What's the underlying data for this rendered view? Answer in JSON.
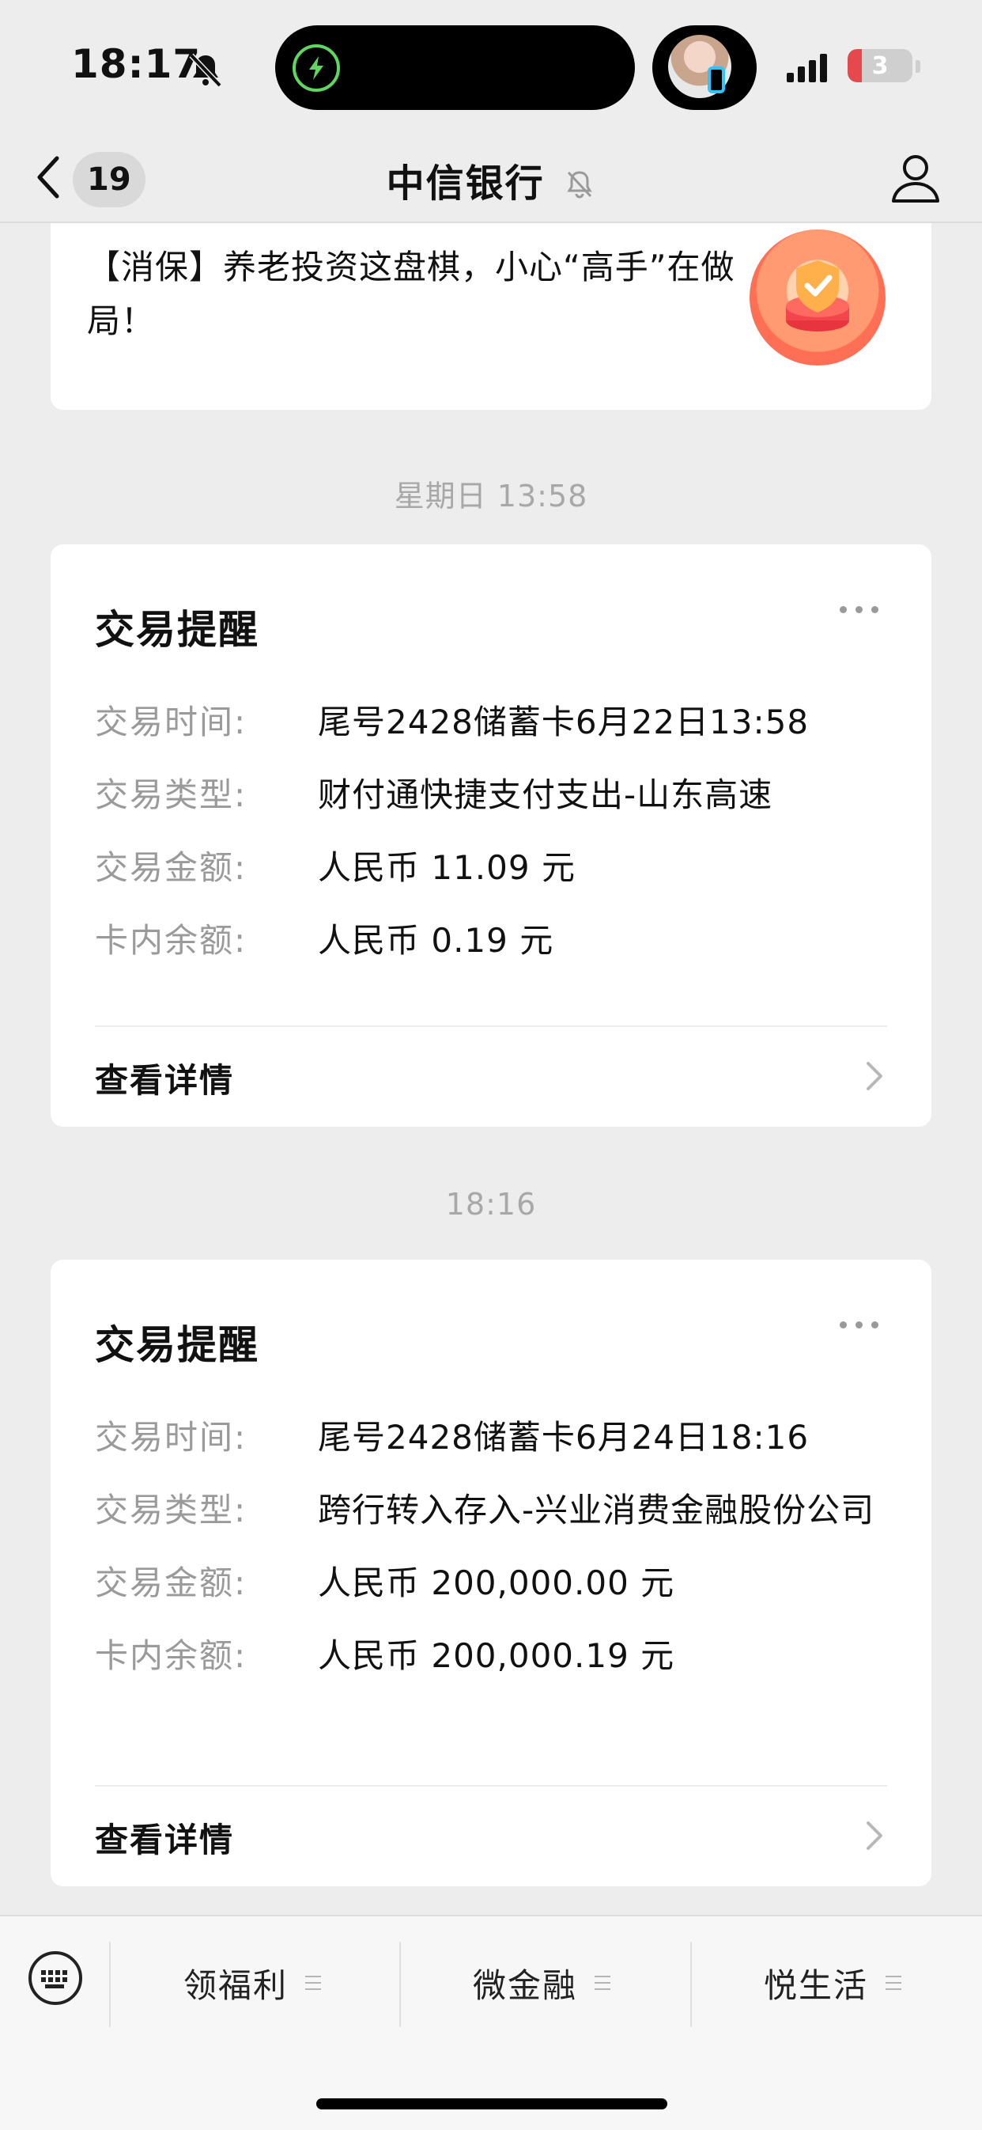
{
  "status_bar": {
    "time": "18:17",
    "battery_level": "3",
    "battery_percent": 3,
    "notifications_muted": true,
    "accent_green": "#5fd65f",
    "battery_red": "#e5484d"
  },
  "nav": {
    "back_icon": "chevron-left-icon",
    "unread_count": "19",
    "title": "中信银行",
    "muted": true,
    "profile_icon": "person-icon"
  },
  "promo": {
    "text": "【消保】养老投资这盘棋，小心“高手”在做局！",
    "thumb_icon": "shield-check-icon"
  },
  "messages": [
    {
      "timestamp": "星期日 13:58",
      "title": "交易提醒",
      "rows": [
        {
          "label": "交易时间:",
          "value": "尾号2428储蓄卡6月22日13:58"
        },
        {
          "label": "交易类型:",
          "value": "财付通快捷支付支出-山东高速"
        },
        {
          "label": "交易金额:",
          "value": "人民币 11.09 元"
        },
        {
          "label": "卡内余额:",
          "value": "人民币 0.19 元"
        }
      ],
      "link": "查看详情"
    },
    {
      "timestamp": "18:16",
      "title": "交易提醒",
      "rows": [
        {
          "label": "交易时间:",
          "value": "尾号2428储蓄卡6月24日18:16"
        },
        {
          "label": "交易类型:",
          "value": "跨行转入存入-兴业消费金融股份公司"
        },
        {
          "label": "交易金额:",
          "value": "人民币 200,000.00 元"
        },
        {
          "label": "卡内余额:",
          "value": "人民币 200,000.19 元"
        }
      ],
      "link": "查看详情"
    }
  ],
  "bottom_menu": {
    "keyboard_icon": "keyboard-icon",
    "items": [
      "领福利",
      "微金融",
      "悦生活"
    ]
  }
}
